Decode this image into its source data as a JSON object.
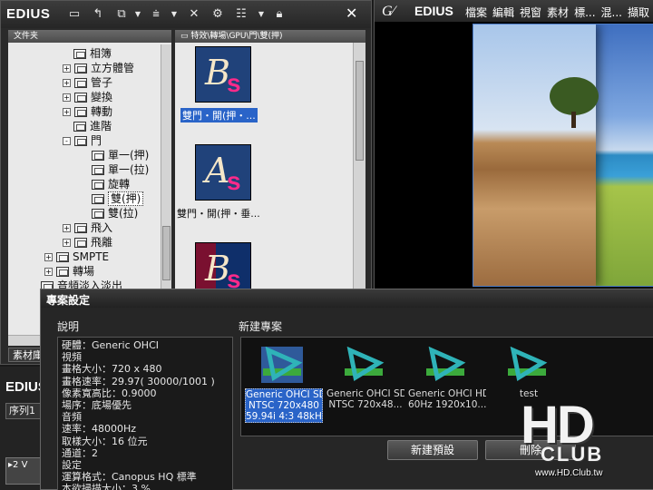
{
  "bin": {
    "title": "EDIUS",
    "tree_header": "文件夹",
    "tab_label": "素材庫",
    "tree_items": [
      {
        "label": "相簿",
        "expander": ""
      },
      {
        "label": "立方體管",
        "expander": "+"
      },
      {
        "label": "管子",
        "expander": "+"
      },
      {
        "label": "變換",
        "expander": "+"
      },
      {
        "label": "轉動",
        "expander": "+"
      },
      {
        "label": "進階",
        "expander": ""
      },
      {
        "label": "門",
        "expander": "-"
      },
      {
        "label": "單一(押)",
        "expander": ""
      },
      {
        "label": "單一(拉)",
        "expander": ""
      },
      {
        "label": "旋轉",
        "expander": ""
      },
      {
        "label": "雙(押)",
        "expander": ""
      },
      {
        "label": "雙(拉)",
        "expander": ""
      },
      {
        "label": "飛入",
        "expander": "+"
      },
      {
        "label": "飛離",
        "expander": "+"
      },
      {
        "label": "SMPTE",
        "expander": "+"
      },
      {
        "label": "轉場",
        "expander": "+"
      },
      {
        "label": "音頻淡入淡出",
        "expander": ""
      }
    ],
    "clip_path": "特效\\轉場\\GPU\\門\\雙(押)",
    "clips": [
      {
        "big": "B",
        "small": "s",
        "label": "雙門・開(押・..."
      },
      {
        "big": "A",
        "small": "s",
        "label": "雙門・開(押・垂..."
      },
      {
        "big": "B",
        "small": "s",
        "label": ""
      }
    ]
  },
  "preview": {
    "title": "EDIUS",
    "menu": [
      "檔案",
      "編輯",
      "視窗",
      "素材",
      "標...",
      "混...",
      "擷取"
    ]
  },
  "timeline": {
    "title": "EDIUS",
    "tab_label": "序列1",
    "track_label": "2 V"
  },
  "dialog": {
    "title": "專案設定",
    "desc_heading": "說明",
    "new_heading": "新建專案",
    "description_lines": [
      "硬體：Generic OHCI",
      "視頻",
      "畫格大小：720 x 480",
      "畫格速率：29.97( 30000/1001 )",
      "像素寬高比：0.9000",
      "場序：底場優先",
      "音頻",
      "速率：48000Hz",
      "取樣大小：16 位元",
      "通道：2",
      "設定",
      "運算格式：Canopus HQ 標準",
      "本欲掃描大小：3 %"
    ],
    "presets": [
      {
        "line1": "Generic OHCI SD",
        "line2": "NTSC 720x480",
        "line3": "59.94i 4:3 48kHz",
        "selected": true
      },
      {
        "line1": "Generic OHCI SD",
        "line2": "NTSC 720x48...",
        "line3": "",
        "selected": false
      },
      {
        "line1": "Generic OHCI HD",
        "line2": "60Hz 1920x10...",
        "line3": "",
        "selected": false
      },
      {
        "line1": "test",
        "line2": "",
        "line3": "",
        "selected": false
      }
    ],
    "buttons": {
      "new_preset": "新建預設",
      "delete": "刪除"
    }
  },
  "watermark": {
    "hd": "HD",
    "club": "CLUB",
    "url": "www.HD.Club.tw"
  },
  "colors": {
    "accent": "#2a64c8",
    "preset_cyan": "#2fb3b8",
    "preset_green": "#3caa3c"
  }
}
